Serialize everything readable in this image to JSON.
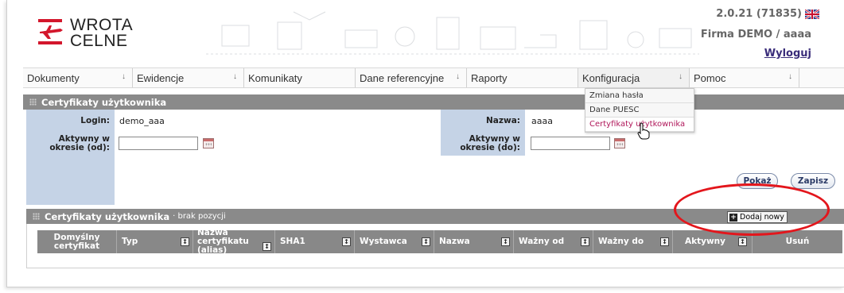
{
  "header": {
    "logo_line1": "WROTA",
    "logo_line2": "CELNE",
    "version": "2.0.21 (71835)",
    "firm": "Firma DEMO / aaaa",
    "logout": "Wyloguj",
    "flag_icon": "uk-flag-icon"
  },
  "nav": {
    "items": [
      {
        "label": "Dokumenty",
        "has_arrow": true
      },
      {
        "label": "Ewidencje",
        "has_arrow": true
      },
      {
        "label": "Komunikaty",
        "has_arrow": false
      },
      {
        "label": "Dane referencyjne",
        "has_arrow": true
      },
      {
        "label": "Raporty",
        "has_arrow": false
      },
      {
        "label": "Konfiguracja",
        "has_arrow": true
      },
      {
        "label": "Pomoc",
        "has_arrow": true
      }
    ],
    "dropdown": [
      "Zmiana hasła",
      "Dane PUESC",
      "Certyfikaty użytkownika"
    ]
  },
  "form": {
    "title": "Certyfikaty użytkownika",
    "login_label": "Login:",
    "login_value": "demo_aaa",
    "name_label": "Nazwa:",
    "name_value": "aaaa",
    "from_label_1": "Aktywny w",
    "from_label_2": "okresie (od):",
    "from_value": "",
    "to_label_1": "Aktywny w",
    "to_label_2": "okresie (do):",
    "to_value": "",
    "show_button": "Pokaż",
    "save_button": "Zapisz"
  },
  "list": {
    "title": "Certyfikaty użytkownika",
    "subtitle": "· brak pozycji",
    "add_button": "Dodaj nowy",
    "columns": [
      {
        "line1": "Domyślny",
        "line2": "certyfikat",
        "sortable": false
      },
      {
        "line1": "Typ",
        "line2": "",
        "sortable": true
      },
      {
        "line1": "Nazwa certyfikatu",
        "line2": "(alias)",
        "sortable": true
      },
      {
        "line1": "SHA1",
        "line2": "",
        "sortable": true
      },
      {
        "line1": "Wystawca",
        "line2": "",
        "sortable": true
      },
      {
        "line1": "Nazwa",
        "line2": "",
        "sortable": true
      },
      {
        "line1": "Ważny od",
        "line2": "",
        "sortable": true
      },
      {
        "line1": "Ważny do",
        "line2": "",
        "sortable": true
      },
      {
        "line1": "Aktywny",
        "line2": "",
        "sortable": true
      },
      {
        "line1": "Usuń",
        "line2": "",
        "sortable": false
      }
    ]
  },
  "colors": {
    "section_bar": "#8a8a8a",
    "label_bg": "#c5d3e6",
    "highlight_oval": "#e3161c",
    "logo_red": "#d3172c"
  }
}
